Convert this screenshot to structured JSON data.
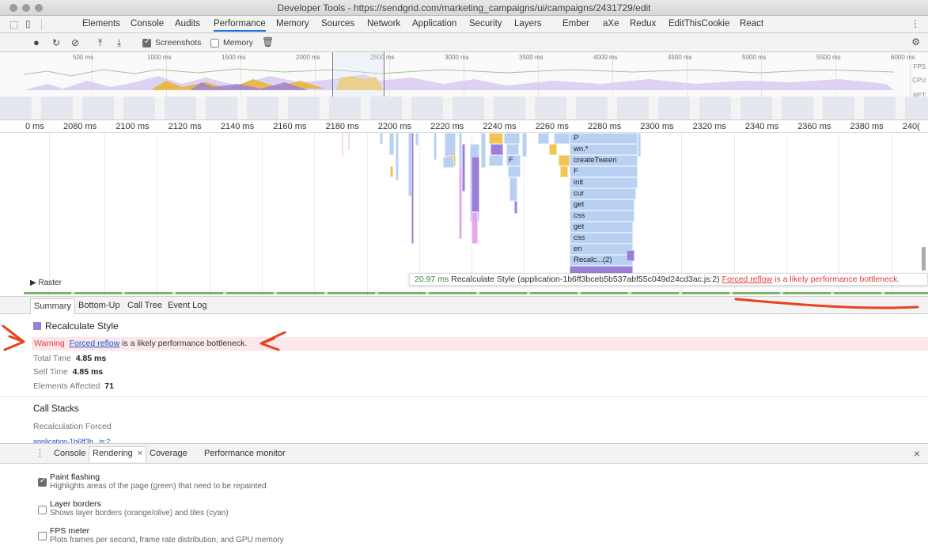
{
  "window": {
    "title": "Developer Tools - https://sendgrid.com/marketing_campaigns/ui/campaigns/2431729/edit"
  },
  "panel_tabs": [
    "Elements",
    "Console",
    "Audits",
    "Performance",
    "Memory",
    "Sources",
    "Network",
    "Application",
    "Security",
    "Layers",
    "Ember",
    "aXe",
    "Redux",
    "EditThisCookie",
    "React"
  ],
  "active_panel": "Performance",
  "toolbar": {
    "screenshots_label": "Screenshots",
    "screenshots_checked": true,
    "memory_label": "Memory",
    "memory_checked": false
  },
  "overview": {
    "ticks": [
      "500 ms",
      "1000 ms",
      "1500 ms",
      "2000 ms",
      "2500 ms",
      "3000 ms",
      "3500 ms",
      "4000 ms",
      "4500 ms",
      "5000 ms",
      "5500 ms",
      "6000 ms"
    ],
    "labels": [
      "FPS",
      "CPU",
      "NET"
    ]
  },
  "flame_ruler": [
    "0 ms",
    "2080 ms",
    "2100 ms",
    "2120 ms",
    "2140 ms",
    "2160 ms",
    "2180 ms",
    "2200 ms",
    "2220 ms",
    "2240 ms",
    "2260 ms",
    "2280 ms",
    "2300 ms",
    "2320 ms",
    "2340 ms",
    "2360 ms",
    "2380 ms",
    "240("
  ],
  "flame_labels": [
    "P",
    "wn.*",
    "createTween",
    "F",
    "init",
    "cur",
    "get",
    "css",
    "get",
    "css",
    "en",
    "Recalc...(2)",
    "F"
  ],
  "raster_label": "▶ Raster",
  "tooltip": {
    "time": "20.97 ms",
    "text": "Recalculate Style (application-1b6ff3bceb5b537abf55c049d24cd3ac.js:2)",
    "link": "Forced reflow",
    "warning": "is a likely performance bottleneck."
  },
  "summary_tabs": [
    "Summary",
    "Bottom-Up",
    "Call Tree",
    "Event Log"
  ],
  "summary": {
    "event_title": "Recalculate Style",
    "warning_label": "Warning",
    "warning_link": "Forced reflow",
    "warning_text": "is a likely performance bottleneck.",
    "total_time_label": "Total Time",
    "total_time": "4.85 ms",
    "self_time_label": "Self Time",
    "self_time": "4.85 ms",
    "elements_affected_label": "Elements Affected",
    "elements_affected": "71",
    "call_stacks_label": "Call Stacks",
    "recalc_forced_label": "Recalculation Forced",
    "stack_entry": "application-1b6ff3b...js:2"
  },
  "drawer_tabs": [
    "Console",
    "Rendering",
    "Coverage",
    "Performance monitor"
  ],
  "drawer_active": "Rendering",
  "rendering_options": [
    {
      "title": "Paint flashing",
      "desc": "Highlights areas of the page (green) that need to be repainted",
      "checked": true
    },
    {
      "title": "Layer borders",
      "desc": "Shows layer borders (orange/olive) and tiles (cyan)",
      "checked": false
    },
    {
      "title": "FPS meter",
      "desc": "Plots frames per second, frame rate distribution, and GPU memory",
      "checked": false
    }
  ],
  "colors": {
    "scripting": "#f1c453",
    "rendering": "#9a7fd8",
    "painting": "#7db36b",
    "js_block": "#b8d0f2",
    "warning": "#e53935",
    "annotation": "#e8411f"
  }
}
